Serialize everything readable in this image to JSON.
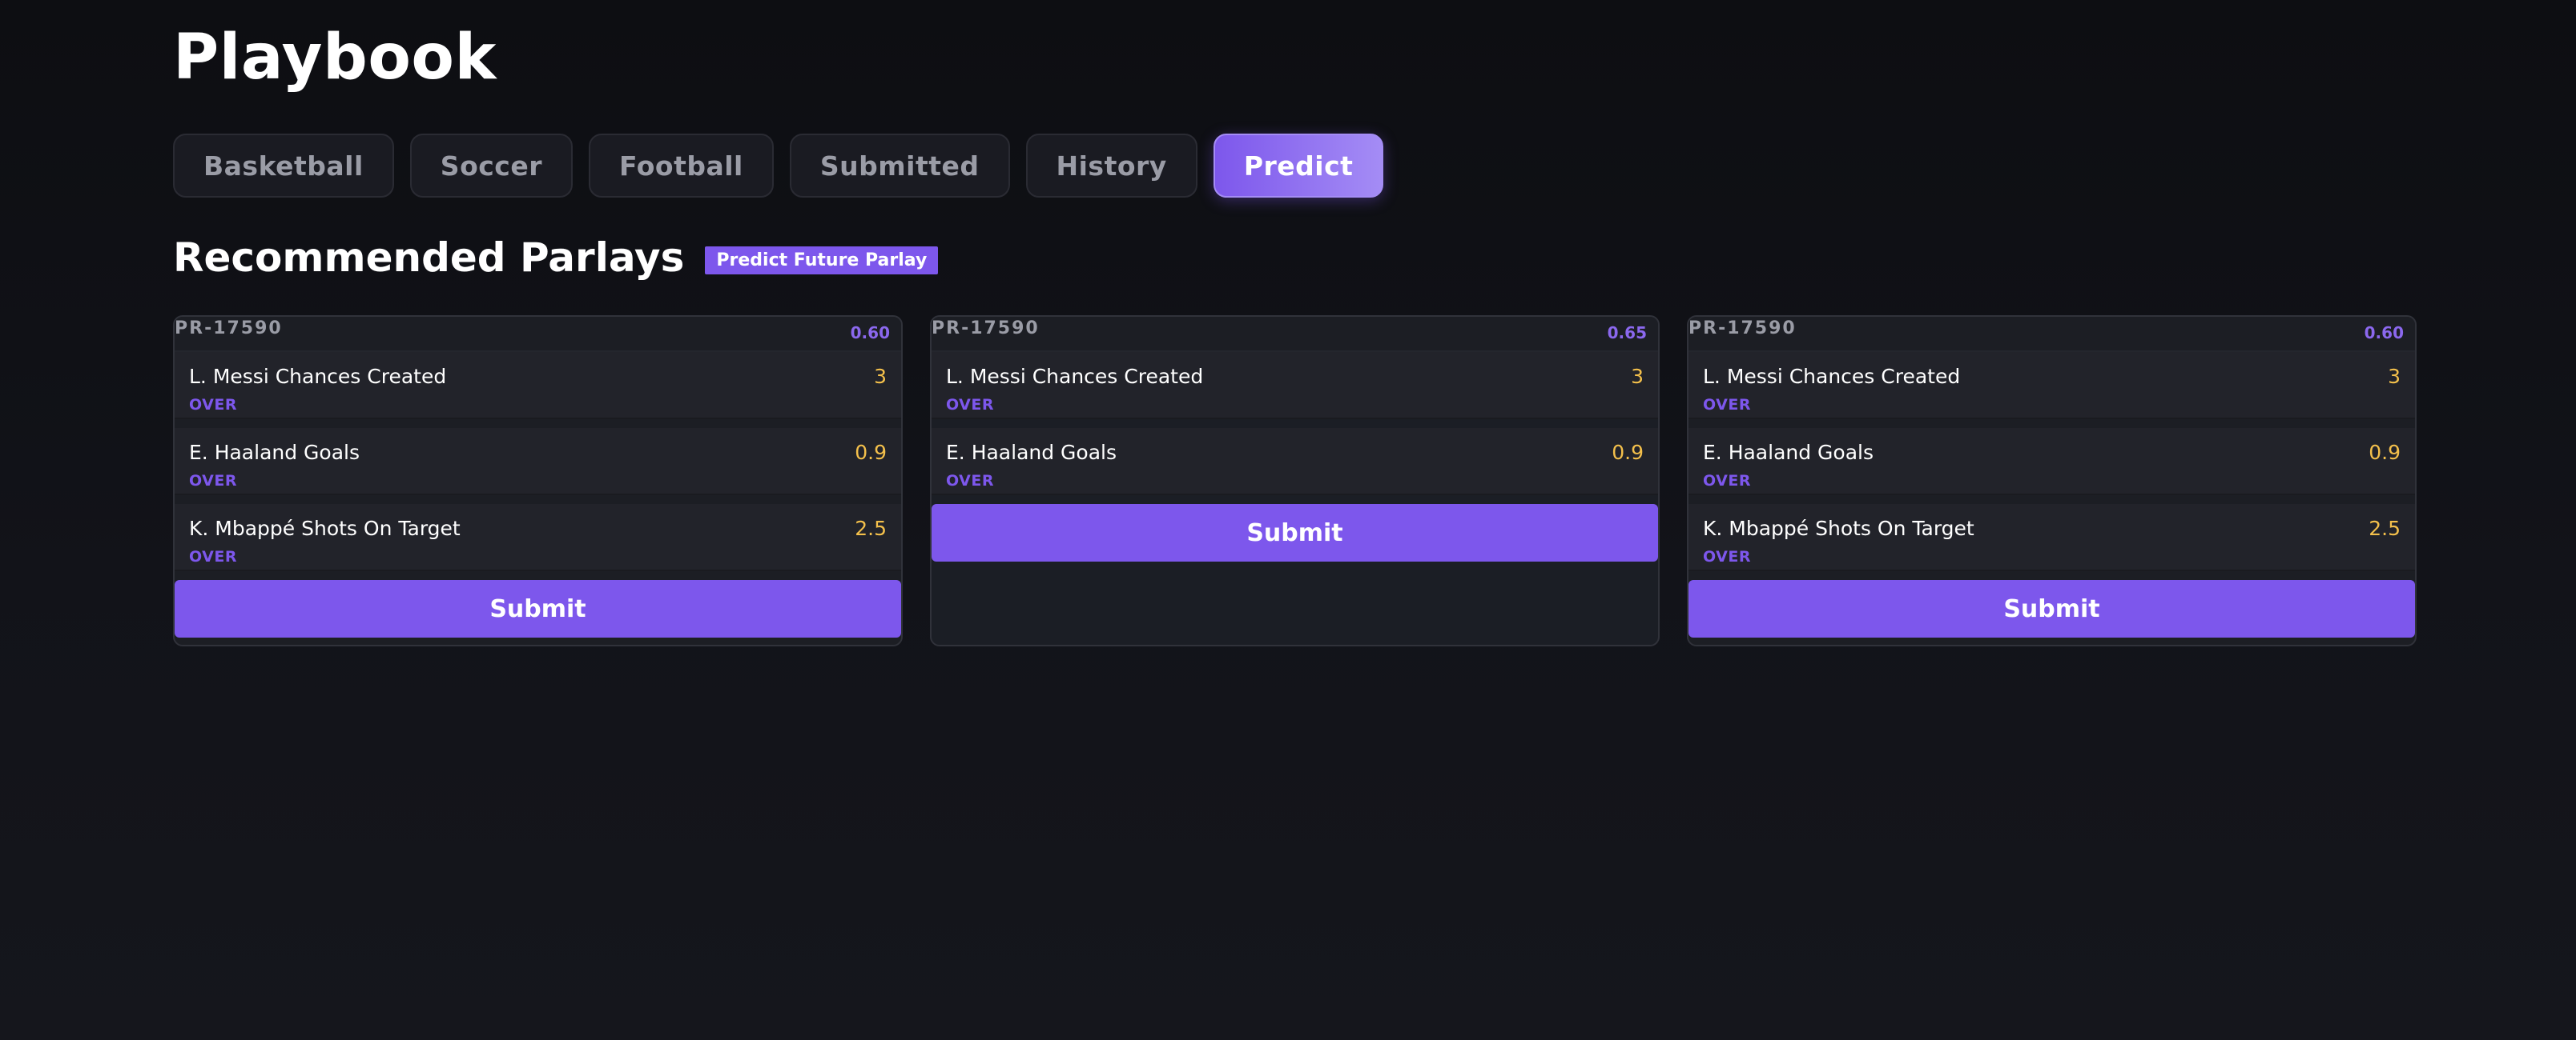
{
  "app": {
    "title": "Playbook"
  },
  "tabs": [
    {
      "label": "Basketball",
      "active": false
    },
    {
      "label": "Soccer",
      "active": false
    },
    {
      "label": "Football",
      "active": false
    },
    {
      "label": "Submitted",
      "active": false
    },
    {
      "label": "History",
      "active": false
    },
    {
      "label": "Predict",
      "active": true
    }
  ],
  "section": {
    "title": "Recommended Parlays",
    "badge": "Predict Future Parlay"
  },
  "cards": [
    {
      "id": "PR-17590",
      "score": "0.60",
      "legs": [
        {
          "name": "L. Messi Chances Created",
          "value": "3",
          "pick": "OVER"
        },
        {
          "name": "E. Haaland Goals",
          "value": "0.9",
          "pick": "OVER"
        },
        {
          "name": "K. Mbappé Shots On Target",
          "value": "2.5",
          "pick": "OVER"
        }
      ],
      "submit_label": "Submit"
    },
    {
      "id": "PR-17590",
      "score": "0.65",
      "legs": [
        {
          "name": "L. Messi Chances Created",
          "value": "3",
          "pick": "OVER"
        },
        {
          "name": "E. Haaland Goals",
          "value": "0.9",
          "pick": "OVER"
        }
      ],
      "submit_label": "Submit"
    },
    {
      "id": "PR-17590",
      "score": "0.60",
      "legs": [
        {
          "name": "L. Messi Chances Created",
          "value": "3",
          "pick": "OVER"
        },
        {
          "name": "E. Haaland Goals",
          "value": "0.9",
          "pick": "OVER"
        },
        {
          "name": "K. Mbappé Shots On Target",
          "value": "2.5",
          "pick": "OVER"
        }
      ],
      "submit_label": "Submit"
    }
  ],
  "colors": {
    "accent": "#7d57ec",
    "value": "#f4c04b",
    "muted": "#9a9ca6"
  }
}
